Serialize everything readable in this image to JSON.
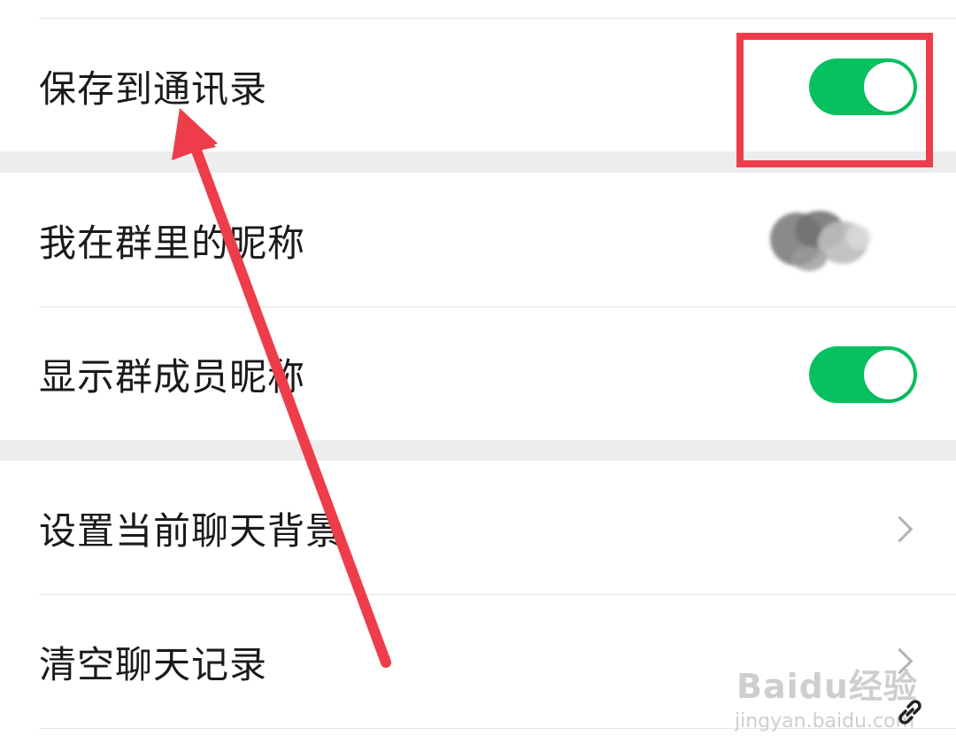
{
  "settings": {
    "save_to_contacts": {
      "label": "保存到通讯录",
      "toggle_on": true
    },
    "my_group_nickname": {
      "label": "我在群里的昵称"
    },
    "show_member_nicknames": {
      "label": "显示群成员昵称",
      "toggle_on": true
    },
    "set_chat_background": {
      "label": "设置当前聊天背景"
    },
    "clear_chat_history": {
      "label": "清空聊天记录"
    }
  },
  "watermark": {
    "logo": "Baidu经验",
    "url": "jingyan.baidu.com"
  },
  "icons": {
    "toggle": "toggle-switch-icon",
    "chevron": "chevron-right-icon",
    "link": "link-icon"
  },
  "colors": {
    "toggle_on": "#07c160",
    "annotation": "#ee3d4a",
    "section_gap": "#ededed",
    "chevron": "#b2b2b2"
  }
}
